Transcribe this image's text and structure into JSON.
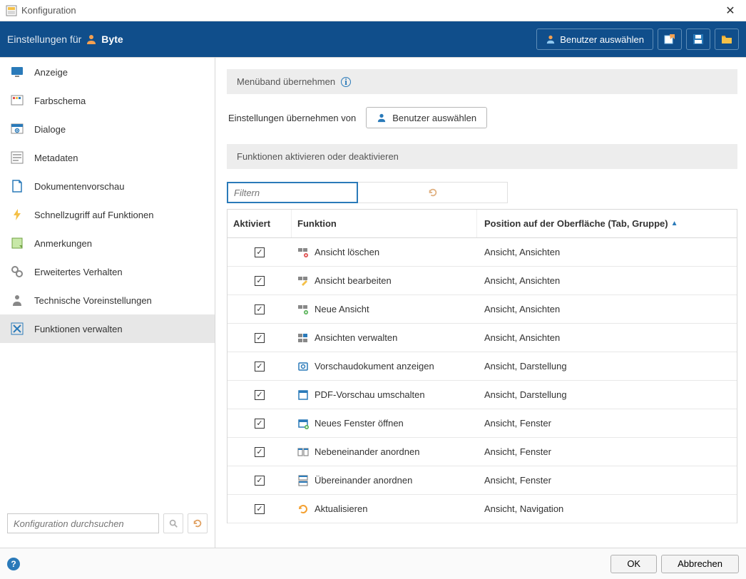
{
  "window": {
    "title": "Konfiguration"
  },
  "header": {
    "prefix": "Einstellungen für",
    "username": "Byte",
    "select_user_label": "Benutzer auswählen"
  },
  "sidebar": {
    "items": [
      {
        "label": "Anzeige"
      },
      {
        "label": "Farbschema"
      },
      {
        "label": "Dialoge"
      },
      {
        "label": "Metadaten"
      },
      {
        "label": "Dokumentenvorschau"
      },
      {
        "label": "Schnellzugriff auf Funktionen"
      },
      {
        "label": "Anmerkungen"
      },
      {
        "label": "Erweitertes Verhalten"
      },
      {
        "label": "Technische Voreinstellungen"
      },
      {
        "label": "Funktionen verwalten"
      }
    ],
    "search_placeholder": "Konfiguration durchsuchen"
  },
  "content": {
    "section1_title": "Menüband übernehmen",
    "adopt_label": "Einstellungen übernehmen von",
    "adopt_button": "Benutzer auswählen",
    "section2_title": "Funktionen aktivieren oder deaktivieren",
    "filter_placeholder": "Filtern",
    "columns": {
      "enabled": "Aktiviert",
      "function": "Funktion",
      "position": "Position auf der Oberfläche (Tab, Gruppe)"
    },
    "rows": [
      {
        "enabled": true,
        "function": "Ansicht löschen",
        "position": "Ansicht, Ansichten"
      },
      {
        "enabled": true,
        "function": "Ansicht bearbeiten",
        "position": "Ansicht, Ansichten"
      },
      {
        "enabled": true,
        "function": "Neue Ansicht",
        "position": "Ansicht, Ansichten"
      },
      {
        "enabled": true,
        "function": "Ansichten verwalten",
        "position": "Ansicht, Ansichten"
      },
      {
        "enabled": true,
        "function": "Vorschaudokument anzeigen",
        "position": "Ansicht, Darstellung"
      },
      {
        "enabled": true,
        "function": "PDF-Vorschau umschalten",
        "position": "Ansicht, Darstellung"
      },
      {
        "enabled": true,
        "function": "Neues Fenster öffnen",
        "position": "Ansicht, Fenster"
      },
      {
        "enabled": true,
        "function": "Nebeneinander anordnen",
        "position": "Ansicht, Fenster"
      },
      {
        "enabled": true,
        "function": "Übereinander anordnen",
        "position": "Ansicht, Fenster"
      },
      {
        "enabled": true,
        "function": "Aktualisieren",
        "position": "Ansicht, Navigation"
      }
    ]
  },
  "footer": {
    "ok": "OK",
    "cancel": "Abbrechen"
  }
}
